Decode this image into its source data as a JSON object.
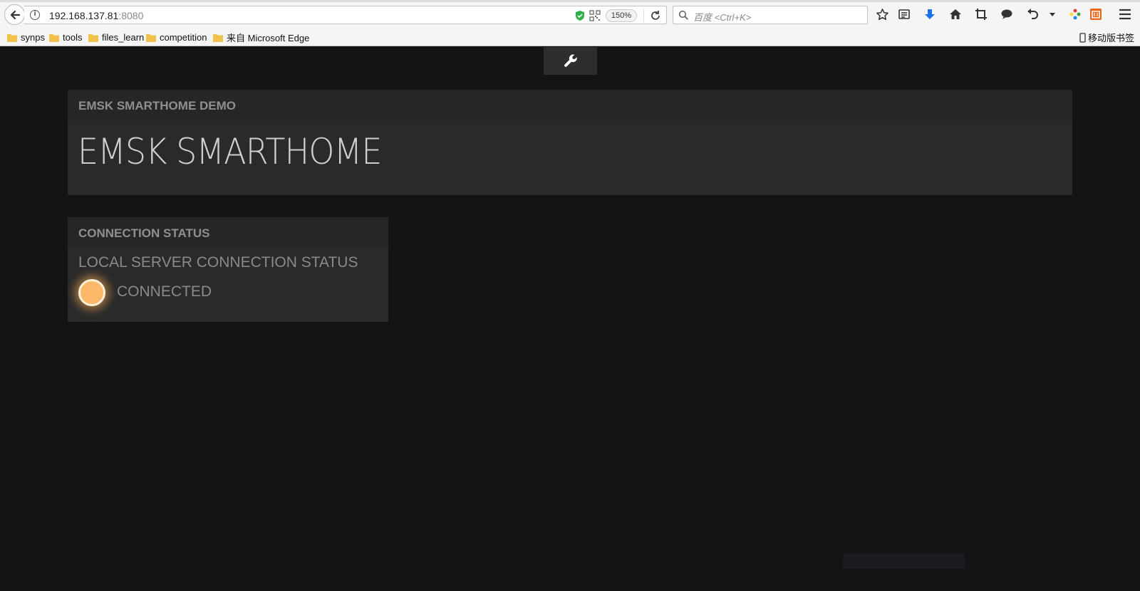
{
  "browser": {
    "url_host": "192.168.137.81",
    "url_port": ":8080",
    "zoom": "150%",
    "search_placeholder": "百度 <Ctrl+K>",
    "bookmarks": [
      "synps",
      "tools",
      "files_learn",
      "competition",
      "来自 Microsoft Edge"
    ],
    "mobile_bookmarks": "移动版书签"
  },
  "page": {
    "title_panel": {
      "header": "EMSK SMARTHOME DEMO",
      "title": "EMSK SMARTHOME"
    },
    "status_panel": {
      "header": "CONNECTION STATUS",
      "label": "LOCAL SERVER CONNECTION STATUS",
      "value": "CONNECTED",
      "indicator_color": "#fdb86a"
    },
    "colors": {
      "background": "#131416",
      "panel": "#2a2a2b",
      "panel_header": "#262627"
    }
  }
}
